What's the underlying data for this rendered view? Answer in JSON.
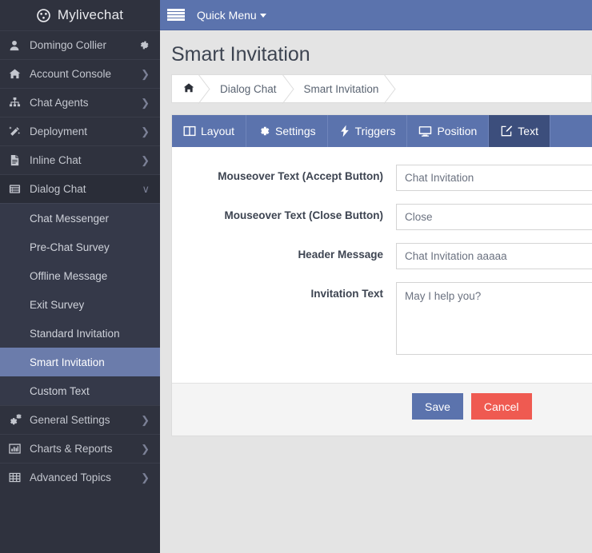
{
  "brand": {
    "name": "Mylivechat",
    "icon": "dashboard-icon"
  },
  "sidebar": {
    "user": {
      "label": "Domingo Collier",
      "icon": "user-icon",
      "settings_icon": "gear-icon"
    },
    "items": [
      {
        "label": "Account Console",
        "icon": "home-icon",
        "arrow": "❯"
      },
      {
        "label": "Chat Agents",
        "icon": "sitemap-icon",
        "arrow": "❯"
      },
      {
        "label": "Deployment",
        "icon": "magic-wand-icon",
        "arrow": "❯"
      },
      {
        "label": "Inline Chat",
        "icon": "file-text-icon",
        "arrow": "❯"
      },
      {
        "label": "Dialog Chat",
        "icon": "window-list-icon",
        "arrow": "∨"
      }
    ],
    "submenu": [
      {
        "label": "Chat Messenger",
        "active": false
      },
      {
        "label": "Pre-Chat Survey",
        "active": false
      },
      {
        "label": "Offline Message",
        "active": false
      },
      {
        "label": "Exit Survey",
        "active": false
      },
      {
        "label": "Standard Invitation",
        "active": false
      },
      {
        "label": "Smart Invitation",
        "active": true
      },
      {
        "label": "Custom Text",
        "active": false
      }
    ],
    "items_bottom": [
      {
        "label": "General Settings",
        "icon": "cogs-icon",
        "arrow": "❯"
      },
      {
        "label": "Charts & Reports",
        "icon": "bar-chart-icon",
        "arrow": "❯"
      },
      {
        "label": "Advanced Topics",
        "icon": "table-grid-icon",
        "arrow": "❯"
      }
    ]
  },
  "topbar": {
    "menu_toggle_icon": "hamburger-icon",
    "quick_menu_label": "Quick Menu",
    "caret_icon": "caret-down-icon"
  },
  "page": {
    "title": "Smart Invitation",
    "breadcrumb": [
      {
        "label": "",
        "icon": "home-icon"
      },
      {
        "label": "Dialog Chat",
        "icon": ""
      },
      {
        "label": "Smart Invitation",
        "icon": ""
      }
    ]
  },
  "tabs": [
    {
      "label": "Layout",
      "icon": "columns-icon",
      "active": false
    },
    {
      "label": "Settings",
      "icon": "gear-icon",
      "active": false
    },
    {
      "label": "Triggers",
      "icon": "bolt-icon",
      "active": false
    },
    {
      "label": "Position",
      "icon": "desktop-icon",
      "active": false
    },
    {
      "label": "Text",
      "icon": "pencil-square-icon",
      "active": true
    }
  ],
  "form": {
    "fields": [
      {
        "label": "Mouseover Text (Accept Button)",
        "value": "Chat Invitation",
        "type": "text"
      },
      {
        "label": "Mouseover Text (Close Button)",
        "value": "Close",
        "type": "text"
      },
      {
        "label": "Header Message",
        "value": "Chat Invitation aaaaa",
        "type": "text"
      },
      {
        "label": "Invitation Text",
        "value": "May I help you?",
        "type": "textarea"
      }
    ],
    "save_label": "Save",
    "cancel_label": "Cancel"
  },
  "colors": {
    "sidebar_bg": "#2f323e",
    "submenu_bg": "#353949",
    "accent": "#5b73ad",
    "active_tab": "#3c4e7c",
    "active_item": "#6b7cab",
    "danger": "#ef5a51"
  }
}
